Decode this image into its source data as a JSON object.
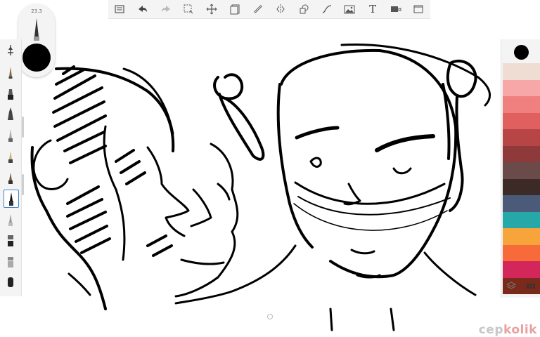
{
  "toolbar": {
    "tools": [
      {
        "name": "gallery-icon"
      },
      {
        "name": "undo-icon"
      },
      {
        "name": "redo-icon"
      },
      {
        "name": "selection-icon"
      },
      {
        "name": "transform-icon"
      },
      {
        "name": "canvas-icon"
      },
      {
        "name": "ruler-icon"
      },
      {
        "name": "symmetry-icon"
      },
      {
        "name": "shape-icon"
      },
      {
        "name": "curve-icon"
      },
      {
        "name": "image-import-icon"
      },
      {
        "name": "text-tool-icon",
        "glyph": "T"
      },
      {
        "name": "fill-icon"
      },
      {
        "name": "fullscreen-icon"
      }
    ]
  },
  "brush_puck": {
    "size_label": "23.3",
    "color": "#000000"
  },
  "brush_library": {
    "selected_index": 9,
    "brushes": [
      "opacity",
      "pencil",
      "marker",
      "fineliner",
      "brush",
      "airbrush",
      "calligraphy",
      "ink",
      "pen",
      "technical-pen",
      "chisel",
      "smudge",
      "eraser"
    ]
  },
  "color_panel": {
    "current_color": "#000000",
    "swatches": [
      "#efddd3",
      "#f7a7a7",
      "#f08080",
      "#e06060",
      "#b84545",
      "#8e3a3a",
      "#6b4a4a",
      "#3b2a26",
      "#4a5a78",
      "#27a8a8",
      "#f7a43a",
      "#f76a3a",
      "#d3265a",
      "#7a2a1a"
    ]
  },
  "watermark": {
    "part1": "cep",
    "part2": "kolik"
  }
}
